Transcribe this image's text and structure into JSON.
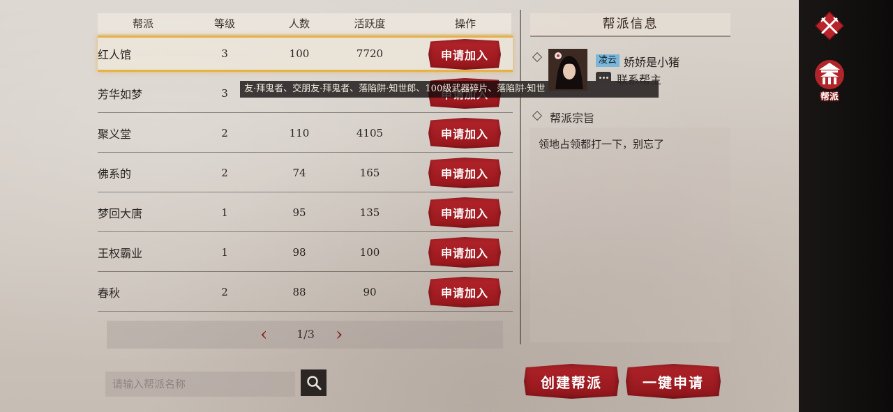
{
  "table": {
    "headers": {
      "name": "帮派",
      "level": "等级",
      "members": "人数",
      "activity": "活跃度",
      "action": "操作"
    },
    "join_label": "申请加入",
    "rows": [
      {
        "name": "红人馆",
        "level": "3",
        "members": "100",
        "activity": "7720"
      },
      {
        "name": "芳华如梦",
        "level": "3",
        "members": "",
        "activity": ""
      },
      {
        "name": "聚义堂",
        "level": "2",
        "members": "110",
        "activity": "4105"
      },
      {
        "name": "佛系的",
        "level": "2",
        "members": "74",
        "activity": "165"
      },
      {
        "name": "梦回大唐",
        "level": "1",
        "members": "95",
        "activity": "135"
      },
      {
        "name": "王权霸业",
        "level": "1",
        "members": "98",
        "activity": "100"
      },
      {
        "name": "春秋",
        "level": "2",
        "members": "88",
        "activity": "90"
      }
    ]
  },
  "marquee": "友·拜鬼者、交朋友·拜鬼者、落陷阱·知世郎、100级武器碎片、落陷阱·知世",
  "pager": {
    "prev": "‹",
    "page": "1/3",
    "next": "›"
  },
  "search": {
    "placeholder": "请输入帮派名称"
  },
  "info": {
    "title": "帮派信息",
    "leader_tag": "凌云",
    "leader_name": "娇娇是小猪",
    "contact_label": "联系帮主",
    "purpose_title": "帮派宗旨",
    "purpose_text": "领地占领都打一下，别忘了"
  },
  "buttons": {
    "create": "创建帮派",
    "apply_all": "一键申请"
  },
  "sidebar": {
    "guild_tab": "帮派"
  },
  "colors": {
    "accent_red": "#a31e24",
    "highlight_gold": "#e5b24a",
    "leader_tag_blue": "#7ab7d8"
  }
}
